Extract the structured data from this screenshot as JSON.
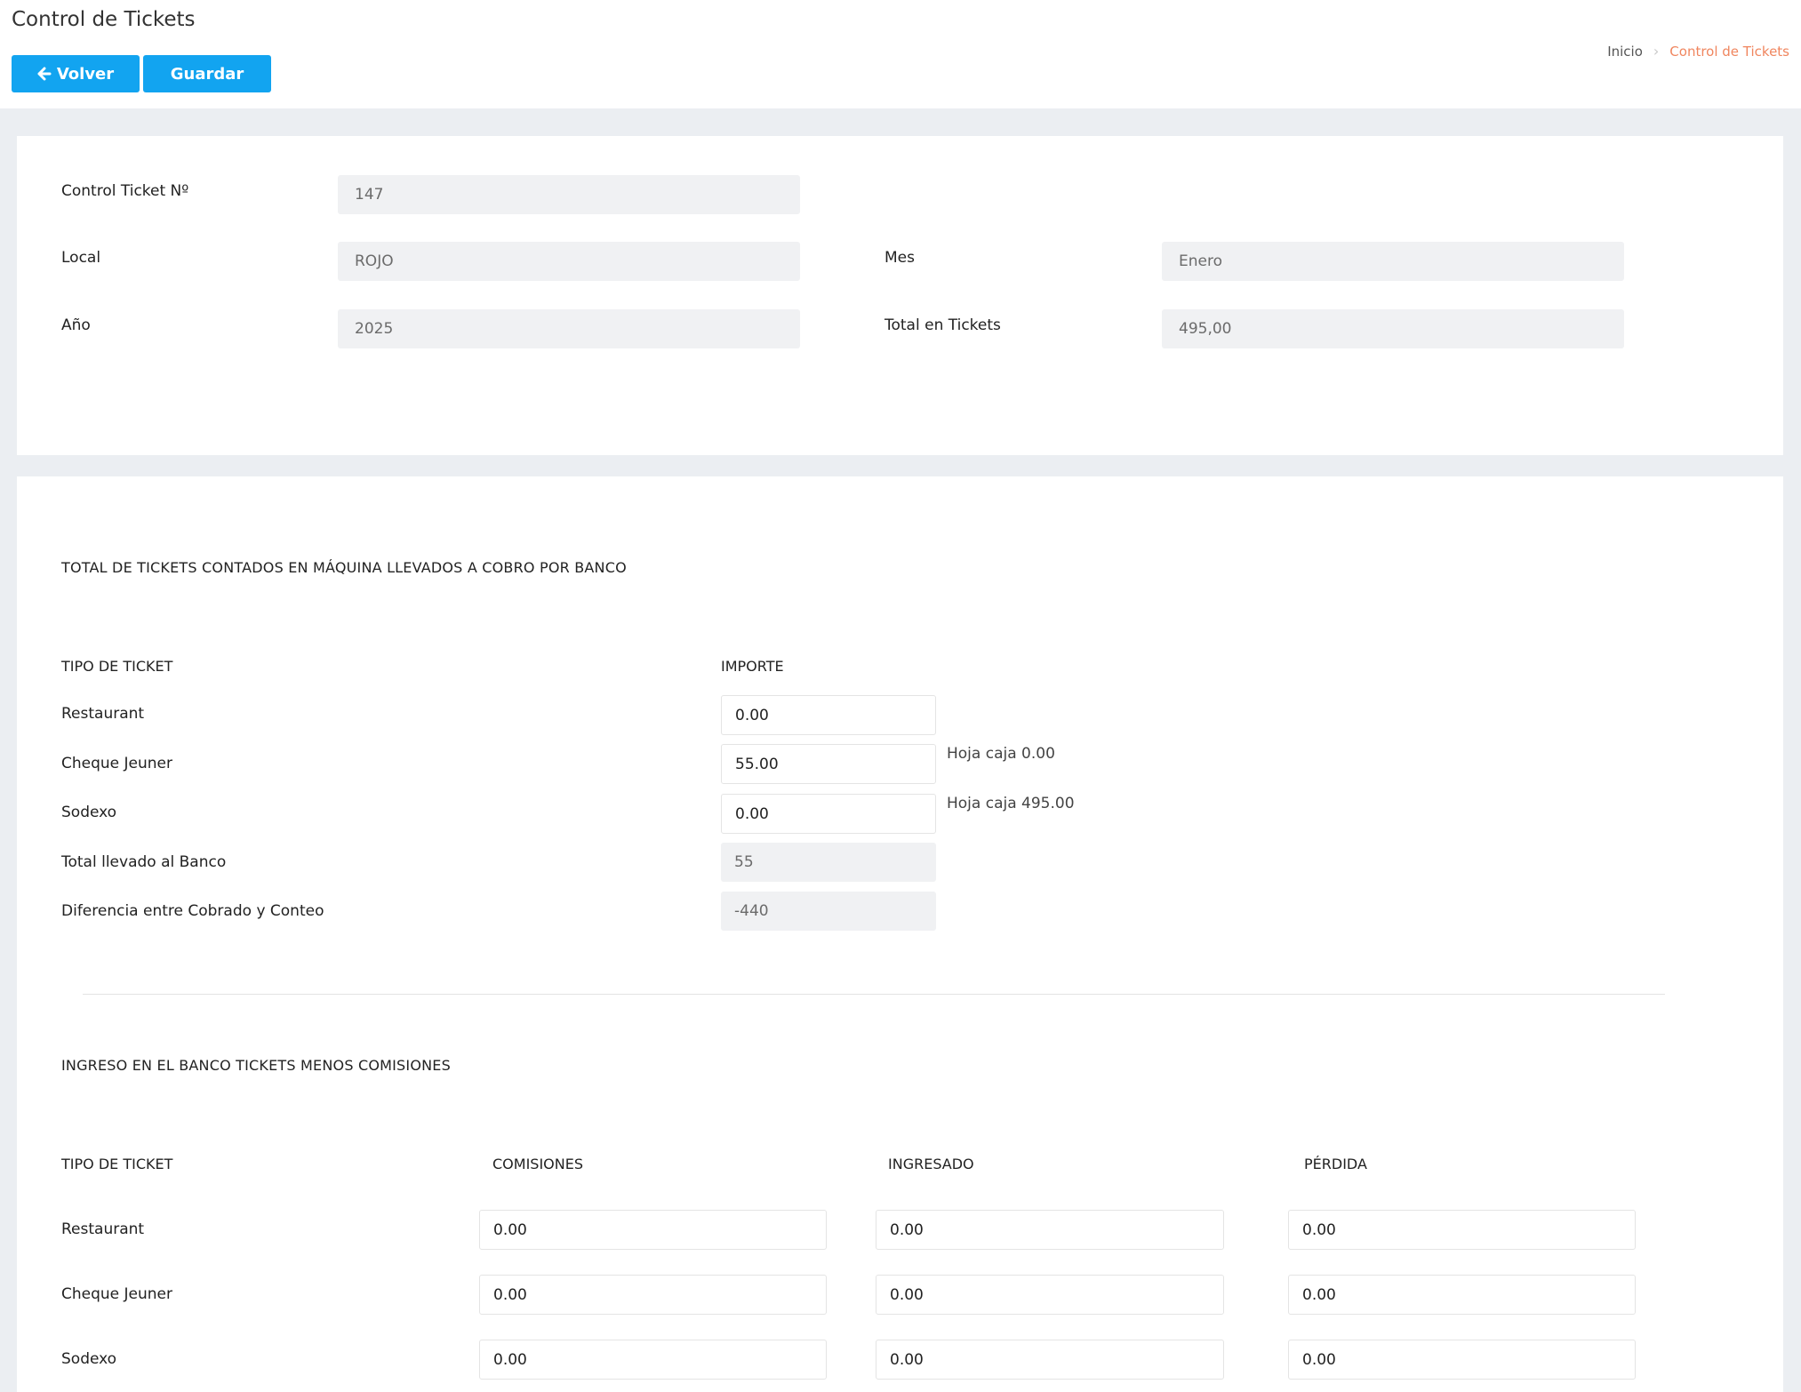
{
  "header": {
    "title": "Control de Tickets",
    "back_label": "Volver",
    "save_label": "Guardar",
    "breadcrumb": {
      "home": "Inicio",
      "current": "Control de Tickets"
    }
  },
  "info": {
    "ticket_no_label": "Control Ticket Nº",
    "ticket_no_value": "147",
    "local_label": "Local",
    "local_value": "ROJO",
    "mes_label": "Mes",
    "mes_value": "Enero",
    "anio_label": "Año",
    "anio_value": "2025",
    "total_label": "Total en Tickets",
    "total_value": "495,00"
  },
  "bank_count": {
    "section_title": "TOTAL DE TICKETS CONTADOS EN MÁQUINA LLEVADOS A COBRO POR BANCO",
    "col_tipo": "TIPO DE TICKET",
    "col_importe": "IMPORTE",
    "rows": [
      {
        "label": "Restaurant",
        "value": "0.00",
        "note": ""
      },
      {
        "label": "Cheque Jeuner",
        "value": "55.00",
        "note": "Hoja caja 0.00"
      },
      {
        "label": "Sodexo",
        "value": "0.00",
        "note": "Hoja caja 495.00"
      }
    ],
    "total_label": "Total llevado al Banco",
    "total_value": "55",
    "diff_label": "Diferencia entre Cobrado y Conteo",
    "diff_value": "-440"
  },
  "bank_income": {
    "section_title": "INGRESO EN EL BANCO TICKETS MENOS COMISIONES",
    "col_tipo": "TIPO DE TICKET",
    "col_comisiones": "COMISIONES",
    "col_ingresado": "INGRESADO",
    "col_perdida": "PÉRDIDA",
    "rows": [
      {
        "label": "Restaurant",
        "comisiones": "0.00",
        "ingresado": "0.00",
        "perdida": "0.00"
      },
      {
        "label": "Cheque Jeuner",
        "comisiones": "0.00",
        "ingresado": "0.00",
        "perdida": "0.00"
      },
      {
        "label": "Sodexo",
        "comisiones": "0.00",
        "ingresado": "0.00",
        "perdida": "0.00"
      }
    ]
  },
  "colors": {
    "primary": "#12a4f0",
    "breadcrumb_active": "#f0865f",
    "background": "#ebeef2"
  }
}
